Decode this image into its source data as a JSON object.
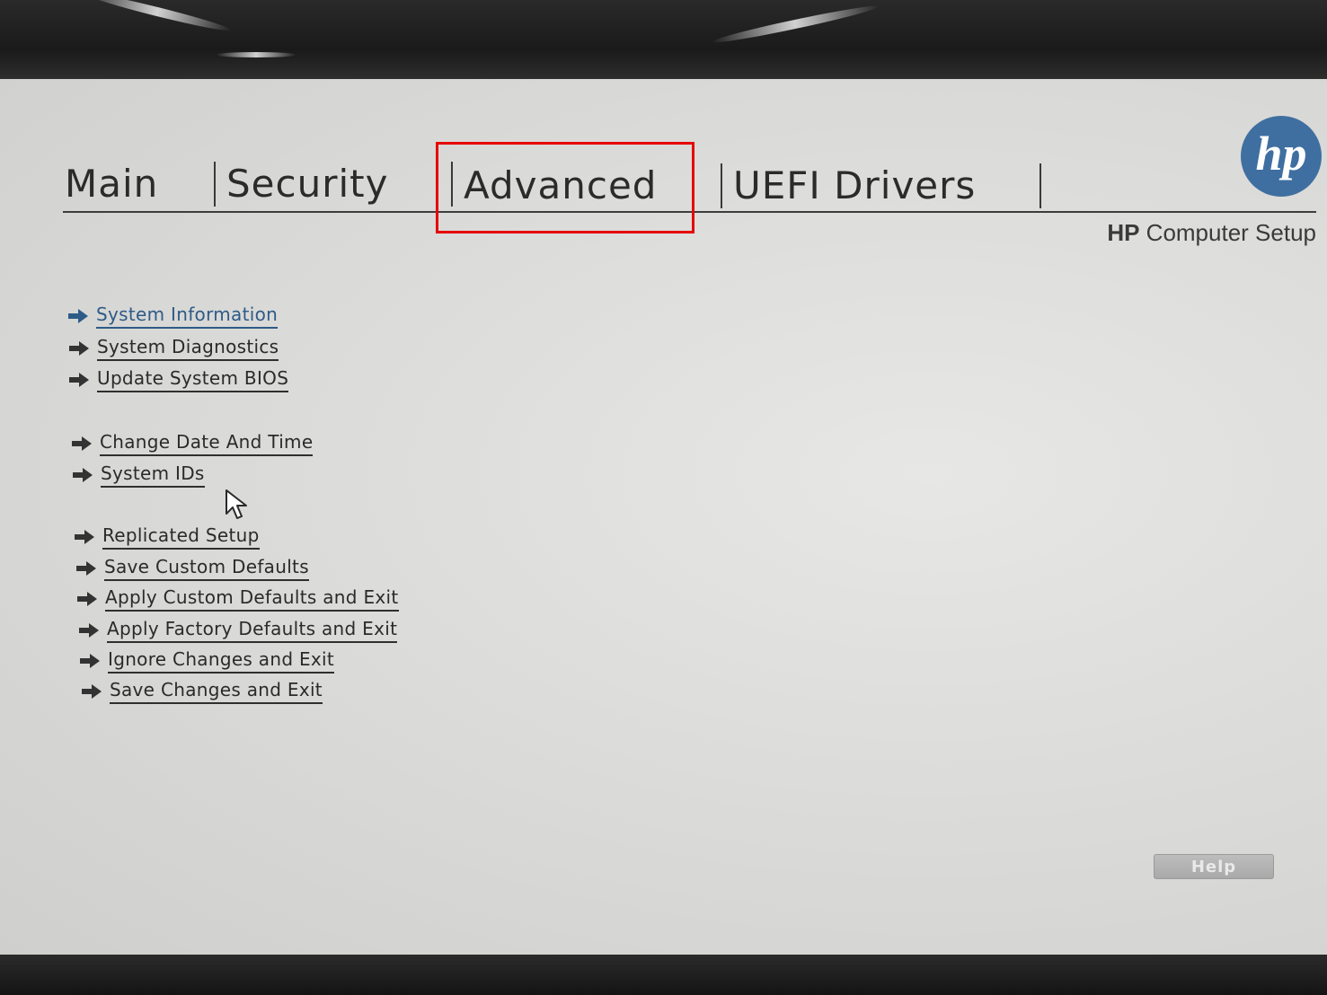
{
  "tabs": [
    {
      "label": "Main"
    },
    {
      "label": "Security"
    },
    {
      "label": "Advanced"
    },
    {
      "label": "UEFI Drivers"
    }
  ],
  "branding": {
    "logo_text": "hp",
    "title_brand": "HP",
    "title_rest": " Computer Setup"
  },
  "menu": {
    "items": [
      {
        "label": "System Information",
        "selected": true
      },
      {
        "label": "System Diagnostics"
      },
      {
        "label": "Update System BIOS"
      },
      {
        "label": "Change Date And Time"
      },
      {
        "label": "System IDs"
      },
      {
        "label": "Replicated Setup"
      },
      {
        "label": "Save Custom Defaults"
      },
      {
        "label": "Apply Custom Defaults and Exit"
      },
      {
        "label": "Apply Factory Defaults and Exit"
      },
      {
        "label": "Ignore Changes and Exit"
      },
      {
        "label": "Save Changes and Exit"
      }
    ]
  },
  "footer": {
    "help_label": "Help"
  },
  "colors": {
    "accent": "#2e5b87",
    "highlight_box": "#e60000",
    "hp_blue": "#3f6fa0"
  },
  "icons": {
    "menu_arrow": "right-arrow-icon",
    "cursor": "mouse-pointer-icon"
  }
}
